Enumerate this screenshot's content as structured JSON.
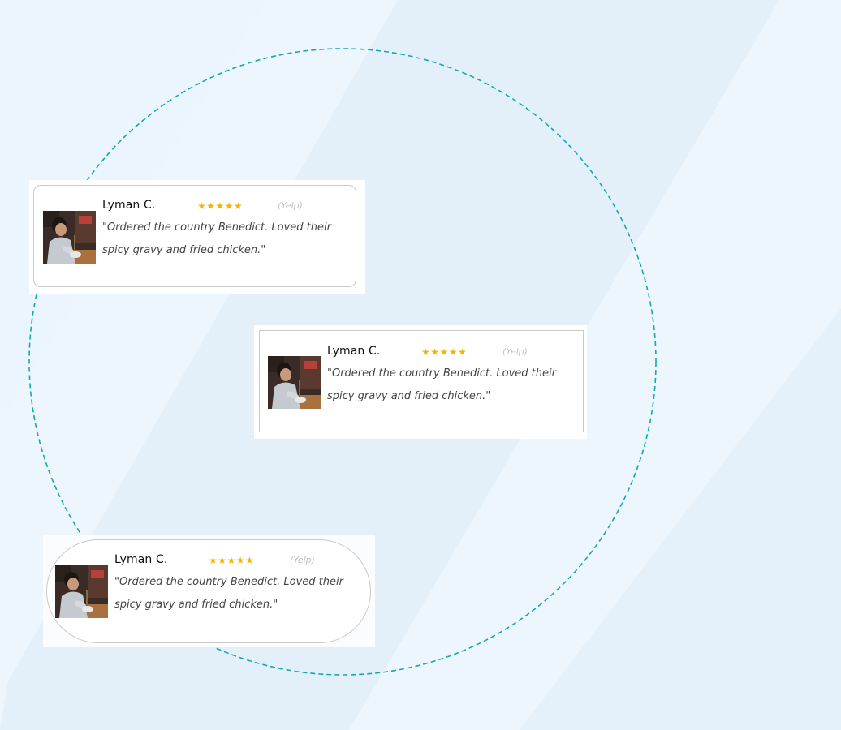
{
  "theme": {
    "background": "#e6f2fb",
    "stripe": "#eef7fd",
    "ring_color": "#13a8b4",
    "star_color": "#f5b400",
    "card_background": "#ffffff"
  },
  "review_cards": [
    {
      "name": "Lyman C.",
      "stars": "★★★★★",
      "rating": 5,
      "source": "(Yelp)",
      "quote": "\"Ordered the country Benedict. Loved their spicy gravy and fried chicken.\"",
      "avatar_icon": "man-eating-photo-icon",
      "style": "rounded"
    },
    {
      "name": "Lyman C.",
      "stars": "★★★★★",
      "rating": 5,
      "source": "(Yelp)",
      "quote": "\"Ordered the country Benedict. Loved their spicy gravy and fried chicken.\"",
      "avatar_icon": "man-eating-photo-icon",
      "style": "square"
    },
    {
      "name": "Lyman C.",
      "stars": "★★★★★",
      "rating": 5,
      "source": "(Yelp)",
      "quote": "\"Ordered the country Benedict. Loved their spicy gravy and fried chicken.\"",
      "avatar_icon": "man-eating-photo-icon",
      "style": "pill"
    }
  ]
}
